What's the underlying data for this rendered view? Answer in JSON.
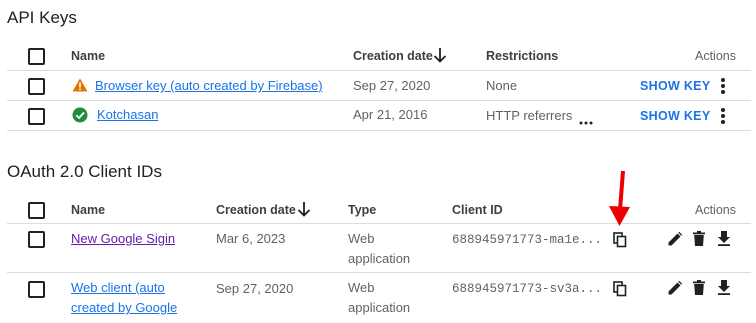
{
  "api_keys": {
    "title": "API Keys",
    "headers": {
      "name": "Name",
      "created": "Creation date",
      "restrictions": "Restrictions",
      "actions": "Actions"
    },
    "rows": [
      {
        "name": "Browser key (auto created by Firebase)",
        "status_icon": "warning-icon",
        "created": "Sep 27, 2020",
        "restrictions": "None",
        "action": "SHOW KEY"
      },
      {
        "name": "Kotchasan",
        "status_icon": "check-circle-icon",
        "created": "Apr 21, 2016",
        "restrictions": "HTTP referrers",
        "action": "SHOW KEY"
      }
    ]
  },
  "oauth": {
    "title": "OAuth 2.0 Client IDs",
    "headers": {
      "name": "Name",
      "created": "Creation date",
      "type": "Type",
      "client_id": "Client ID",
      "actions": "Actions"
    },
    "rows": [
      {
        "name_line1": "New Google Sigin",
        "name_line2": "",
        "created": "Mar 6, 2023",
        "type_line1": "Web",
        "type_line2": "application",
        "client_id": "688945971773-ma1e..."
      },
      {
        "name_line1": "Web client (auto",
        "name_line2": "created by Google",
        "created": "Sep 27, 2020",
        "type_line1": "Web",
        "type_line2": "application",
        "client_id": "688945971773-sv3a..."
      }
    ]
  },
  "colors": {
    "accent": "#1a73e8",
    "warning": "#e37400",
    "success": "#1e8e3e",
    "arrow": "#ea0000",
    "visited": "#681da8"
  }
}
